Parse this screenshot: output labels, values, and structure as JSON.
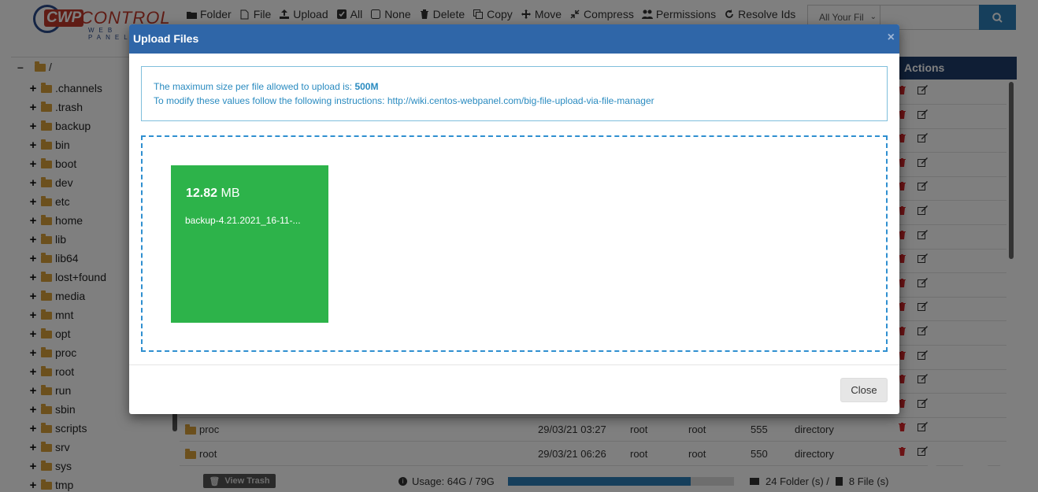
{
  "logo": {
    "badge": "CWP",
    "name": "CONTROL",
    "sub": "WEB PANEL"
  },
  "toolbar": {
    "buttons": [
      {
        "label": "Folder",
        "icon": "folder-icon"
      },
      {
        "label": "File",
        "icon": "file-icon"
      },
      {
        "label": "Upload",
        "icon": "upload-icon"
      },
      {
        "label": "All",
        "icon": "checkbox-checked-icon"
      },
      {
        "label": "None",
        "icon": "checkbox-empty-icon"
      },
      {
        "label": "Delete",
        "icon": "trash-icon"
      },
      {
        "label": "Copy",
        "icon": "copy-icon"
      },
      {
        "label": "Move",
        "icon": "move-icon"
      },
      {
        "label": "Compress",
        "icon": "compress-icon"
      },
      {
        "label": "Permissions",
        "icon": "users-icon"
      },
      {
        "label": "Resolve Ids",
        "icon": "refresh-icon"
      }
    ]
  },
  "search": {
    "filter_value": "All Your Fil",
    "query": ""
  },
  "tree": {
    "root": "/",
    "items": [
      ".channels",
      ".trash",
      "backup",
      "bin",
      "boot",
      "dev",
      "etc",
      "home",
      "lib",
      "lib64",
      "lost+found",
      "media",
      "mnt",
      "opt",
      "proc",
      "root",
      "run",
      "sbin",
      "scripts",
      "srv",
      "sys",
      "tmp"
    ]
  },
  "table": {
    "actions_header": "Actions",
    "rows": [
      {
        "name": "proc",
        "date": "29/03/21 03:27",
        "owner": "root",
        "group": "root",
        "perm": "555",
        "type": "directory"
      },
      {
        "name": "root",
        "date": "29/03/21 06:26",
        "owner": "root",
        "group": "root",
        "perm": "550",
        "type": "directory"
      }
    ]
  },
  "footer": {
    "view_trash": "View Trash",
    "usage": "Usage: 64G / 79G",
    "usage_fraction": 0.81,
    "folders": "24 Folder (s) /",
    "files": "8 File (s)"
  },
  "modal": {
    "title": "Upload Files",
    "close_icon": "×",
    "info_line1_prefix": "The maximum size per file allowed to upload is: ",
    "info_line1_value": "500M",
    "info_line2_prefix": "To modify these values follow the following instructions: ",
    "info_link": "http://wiki.centos-webpanel.com/big-file-upload-via-file-manager",
    "file": {
      "size_value": "12.82",
      "size_unit": "MB",
      "name": "backup-4.21.2021_16-11-..."
    },
    "close_button": "Close"
  },
  "colors": {
    "header_blue": "#2f66a8",
    "tile_green": "#2db34a",
    "info_blue": "#2a8bc0",
    "table_head": "#1f3d6b"
  }
}
